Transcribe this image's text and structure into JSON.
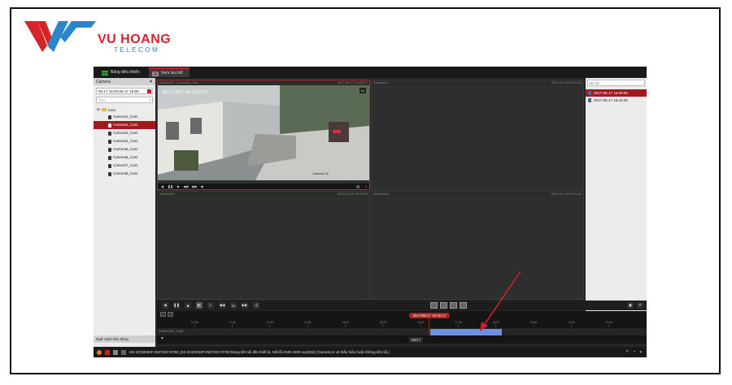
{
  "brand": {
    "line1": "VU HOANG",
    "line2": "TELECOM"
  },
  "colors": {
    "accent": "#c8202a",
    "brand_red": "#d8232a",
    "brand_blue": "#2a86c8",
    "playback_bar": "#6f8ee6"
  },
  "tabs": [
    {
      "label": "Bảng điều khiển",
      "icon": "grid-icon"
    },
    {
      "label": "Xem lưu trữ",
      "icon": "playback-icon"
    }
  ],
  "left_panel": {
    "title": "Camera",
    "date_range": "06-17 15:00-06-17 15:59",
    "search_placeholder": "Tìm...",
    "root": "Cam",
    "cameras": [
      "Camera1_Cam",
      "Camera2_Cam",
      "Camera3_Cam",
      "Camera4_Cam",
      "Camera5_Cam",
      "Camera6_Cam",
      "Camera7_Cam",
      "Camera8_Cam"
    ],
    "selected_camera": "Camera2_Cam",
    "footer": "Ngữ cảnh bảo động"
  },
  "videos": [
    {
      "title": "Window01: Camera2_Cam",
      "time": "2017-06-17 15:00:17",
      "speed": "1x",
      "overlay_date": "06-17-2017 Sat 15:00:17",
      "overlay_cam": "Camera 02"
    },
    {
      "title": "Window02",
      "time": "0000-00-00 00:00:00"
    },
    {
      "title": "Window03",
      "time": "0000-00-00 00:00:00"
    },
    {
      "title": "Window04",
      "time": "0000-00-00 00:00:00"
    }
  ],
  "right_panel": {
    "search_placeholder": "Bộ lọc",
    "items": [
      "2017-06-17 15:00:00",
      "2017-06-17 15:43:39"
    ]
  },
  "controls": {
    "speed": "1x"
  },
  "timeline": {
    "current": "2017/06/17 15:00:17",
    "track_label": "Camera2_Cam",
    "date": "06/17",
    "ticks": [
      "10:00",
      "11:00",
      "12:00",
      "13:00",
      "14:00",
      "15:00",
      "16:00",
      "17:00",
      "18:00",
      "19:00",
      "20:00",
      "21:00"
    ],
    "playback_start": "15:00",
    "playback_end": "17:00"
  },
  "status": {
    "message": "DS-2CD2020F-IN0720170793_DS-2CD2020F-IN0720170793 Đang kết nối đến thiết bị. Mã lỗi HNR-4200 xxx(002) (Camera tx và thấu hiểu hoặc không kết nối.)"
  }
}
